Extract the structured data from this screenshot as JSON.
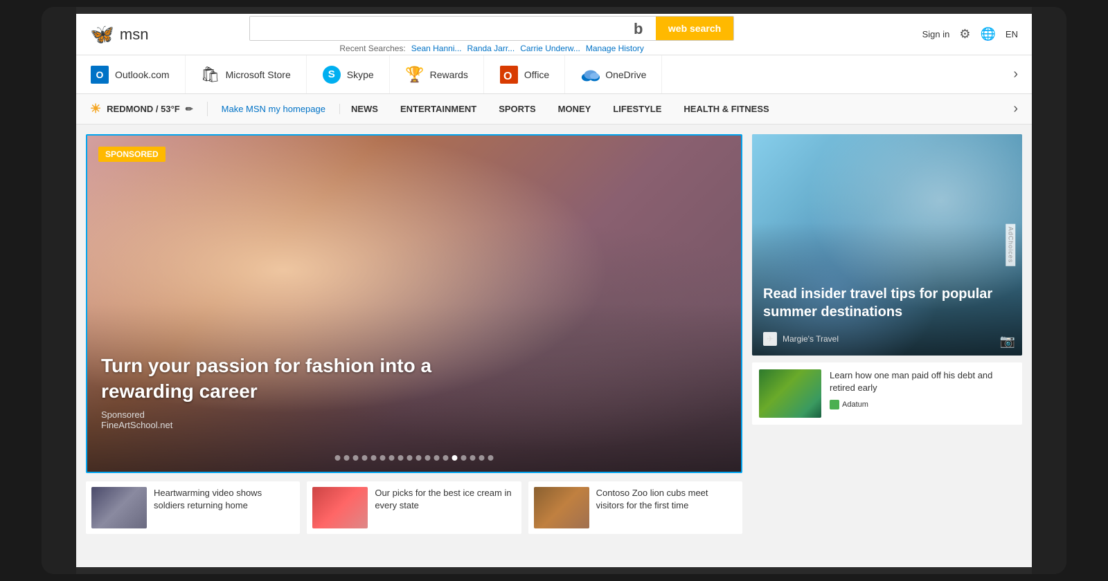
{
  "logo": {
    "icon": "🦋",
    "text": "msn"
  },
  "search": {
    "placeholder": "",
    "bing_letter": "b",
    "button_label": "web search"
  },
  "recent_searches": {
    "label": "Recent Searches:",
    "items": [
      "Sean Hanni...",
      "Randa Jarr...",
      "Carrie Underw..."
    ],
    "manage": "Manage History"
  },
  "header_right": {
    "sign_in": "Sign in",
    "lang": "EN"
  },
  "nav_items": [
    {
      "label": "Outlook.com",
      "icon": "outlook"
    },
    {
      "label": "Microsoft Store",
      "icon": "store"
    },
    {
      "label": "Skype",
      "icon": "skype"
    },
    {
      "label": "Rewards",
      "icon": "rewards"
    },
    {
      "label": "Office",
      "icon": "office"
    },
    {
      "label": "OneDrive",
      "icon": "onedrive"
    }
  ],
  "toolbar": {
    "location": "REDMOND / 53°F",
    "homepage_link": "Make MSN my homepage",
    "nav_links": [
      "NEWS",
      "ENTERTAINMENT",
      "SPORTS",
      "MONEY",
      "LIFESTYLE",
      "HEALTH & FITNESS"
    ]
  },
  "hero": {
    "sponsored_label": "SPONSORED",
    "title": "Turn your passion for fashion into a rewarding career",
    "source_label": "Sponsored",
    "source_name": "FineArtSchool.net",
    "dots_count": 18,
    "active_dot": 14
  },
  "ad": {
    "title": "Read insider travel tips for popular summer destinations",
    "source": "Margie's Travel"
  },
  "news_right": {
    "title": "Learn how one man paid off his debt and retired early",
    "source": "Adatum"
  },
  "bottom_news": [
    {
      "title": "Heartwarming video shows soldiers returning home",
      "thumb_type": "soldiers"
    },
    {
      "title": "Our picks for the best ice cream in every state",
      "thumb_type": "icecream"
    },
    {
      "title": "Contoso Zoo lion cubs meet visitors for the first time",
      "thumb_type": "zoo"
    }
  ]
}
